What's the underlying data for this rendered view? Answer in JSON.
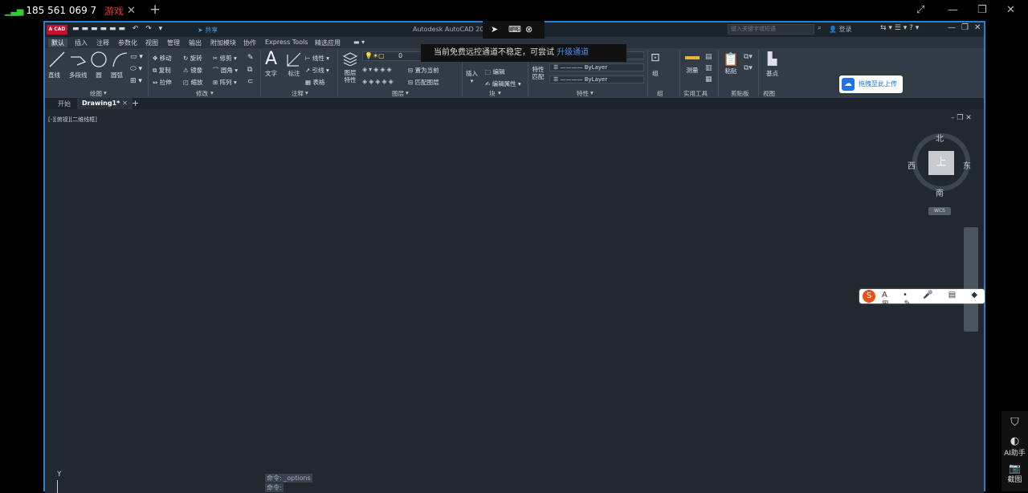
{
  "remote": {
    "signal_icon": "signal-bars-icon",
    "phone": "185 561 069 7",
    "tab_label": "游戏",
    "tab_close": "✕",
    "tab_add": "+",
    "notice_text": "当前免费远控通道不稳定，可尝试",
    "notice_link": "升级通道"
  },
  "acad": {
    "app_badge": "A CAD",
    "title": "Autodesk AutoCAD 2023",
    "share": "共享",
    "search_placeholder": "键入关键字或短语",
    "login": "登录",
    "ribbon_tabs": [
      "默认",
      "插入",
      "注释",
      "参数化",
      "视图",
      "管理",
      "输出",
      "附加模块",
      "协作",
      "Express Tools",
      "精选应用"
    ],
    "draw": {
      "line": "直线",
      "polyline": "多段线",
      "circle": "圆",
      "arc": "圆弧",
      "group": "绘图"
    },
    "modify": {
      "move": "移动",
      "rotate": "旋转",
      "trim": "修剪",
      "copy": "复制",
      "mirror": "镜像",
      "fillet": "圆角",
      "stretch": "拉伸",
      "scale": "缩放",
      "array": "阵列",
      "group": "修改"
    },
    "annotation": {
      "text": "文字",
      "dim": "标注",
      "linear": "线性",
      "leader": "引线",
      "table": "表格",
      "group": "注释"
    },
    "layers": {
      "props": "图层特性",
      "layer_value": "0",
      "make_current": "置为当前",
      "match": "匹配图层",
      "group": "图层"
    },
    "block": {
      "insert": "插入",
      "edit": "编辑",
      "edit_attr": "编辑属性",
      "group": "块"
    },
    "properties": {
      "match": "特性匹配",
      "bylayer1": "ByLayer",
      "bylayer2": "ByLayer",
      "group": "特性"
    },
    "groups": {
      "group": "组",
      "utilities": "实用工具",
      "measure": "测量",
      "clipboard": "剪贴板",
      "paste": "粘贴",
      "view": "视图",
      "base": "基点"
    },
    "drag_upload": "拖拽至此上传",
    "doc_tabs": {
      "start": "开始",
      "drawing": "Drawing1*"
    },
    "viewport_label": "[-][俯视][二维线框]",
    "viewcube": {
      "north": "北",
      "south": "南",
      "east": "东",
      "west": "西",
      "top": "上",
      "wcs": "WCS"
    },
    "command_lines": [
      "命令: _options",
      "命令:"
    ],
    "ucs_y": "Y"
  },
  "side": {
    "ai_label": "AI助手",
    "screenshot_label": "截图"
  },
  "colors": {
    "accent": "#2f80c8",
    "canvas": "#212830",
    "ribbon": "#323c47"
  }
}
